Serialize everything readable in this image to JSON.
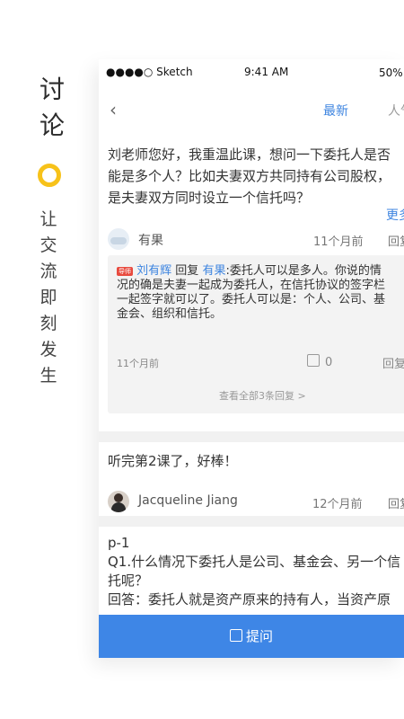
{
  "promo": {
    "title_chars": [
      "讨",
      "论"
    ],
    "slogan_chars": [
      "让",
      "交",
      "流",
      "即",
      "刻",
      "发",
      "生"
    ]
  },
  "status_bar": {
    "signal": "●●●●○ Sketch",
    "time": "9:41 AM",
    "battery": "50%"
  },
  "nav": {
    "back_icon": "‹",
    "tab_latest": "最新",
    "tab_popular": "人气"
  },
  "card1": {
    "question_lines": [
      "刘老师您好，我重温此课，想问一下委托人是否",
      "能是多个人？比如夫妻双方共同持有公司股权，",
      "是夫妻双方同时设立一个信托吗？"
    ],
    "more": "更多",
    "author": "有果",
    "time": "11个月前",
    "reply": "回复",
    "reply_box": {
      "tag": "导师",
      "replier": "刘有辉",
      "reply_word": "回复",
      "target": "有果",
      "lines": [
        ":委托人可以是多人。你说的情",
        "况的确是夫妻一起成为委托人，在信托协议的签字栏",
        "一起签字就可以了。委托人可以是：个人、公司、基",
        "金会、组织和信托。"
      ],
      "time": "11个月前",
      "likes": "0",
      "reply": "回复",
      "view_all": "查看全部3条回复 >"
    }
  },
  "card2": {
    "text": "听完第2课了，好棒！",
    "author": "Jacqueline Jiang",
    "time": "12个月前",
    "reply": "回复"
  },
  "card3": {
    "lines": [
      "p-1",
      "Q1.什么情况下委托人是公司、基金会、另一个信",
      "托呢？",
      "回答：委托人就是资产原来的持有人，当资产原"
    ]
  },
  "ask_button": "提问"
}
